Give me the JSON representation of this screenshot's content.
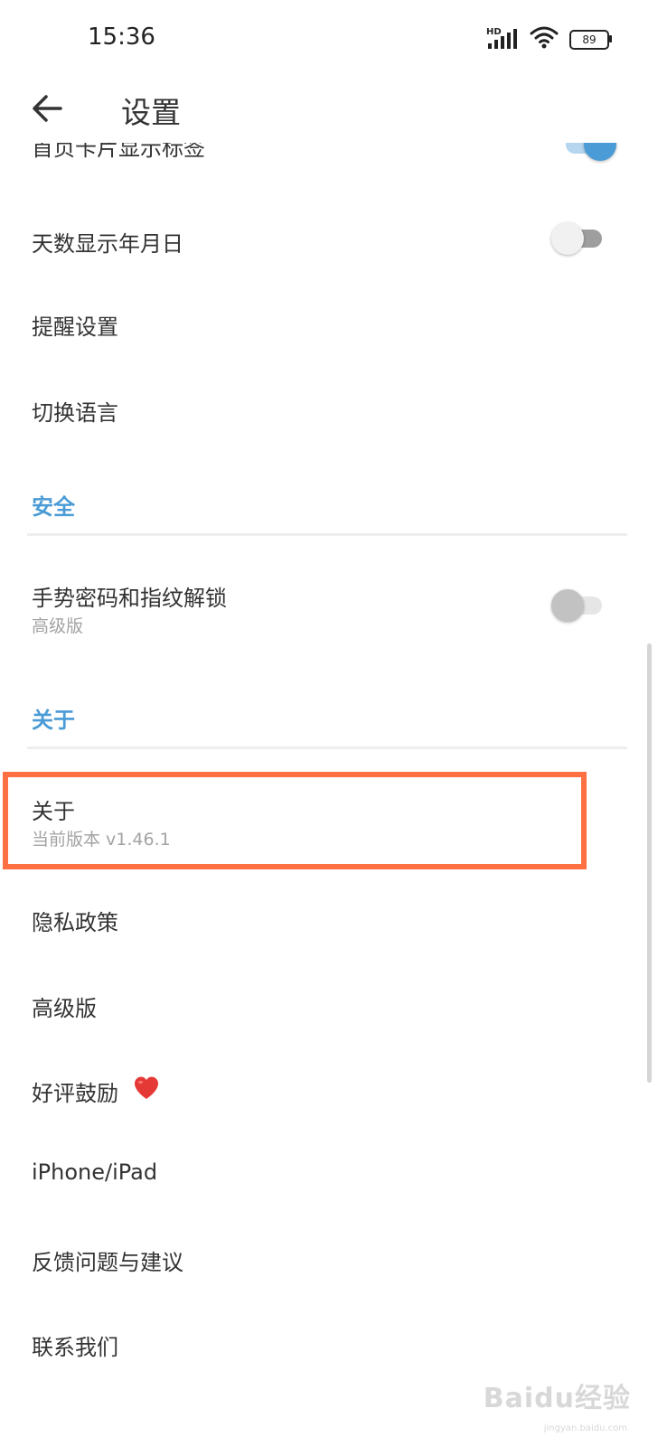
{
  "status_bar": {
    "time": "15:36",
    "network_label": "HD",
    "battery": "89"
  },
  "toolbar": {
    "title": "设置",
    "back_icon": "arrow-left-icon"
  },
  "settings": {
    "partial_item": {
      "label": "首页卡片显示标签",
      "toggle": "on"
    },
    "items_general": [
      {
        "label": "天数显示年月日",
        "toggle": "off"
      },
      {
        "label": "提醒设置"
      },
      {
        "label": "切换语言"
      }
    ],
    "section_security": {
      "title": "安全",
      "items": [
        {
          "label": "手势密码和指纹解锁",
          "sublabel": "高级版",
          "toggle": "off"
        }
      ]
    },
    "section_about": {
      "title": "关于",
      "items": [
        {
          "label": "关于",
          "sublabel": "当前版本 v1.46.1",
          "highlighted": true
        },
        {
          "label": "隐私政策"
        },
        {
          "label": "高级版"
        },
        {
          "label": "好评鼓励",
          "icon": "heart-icon"
        },
        {
          "label": "iPhone/iPad"
        },
        {
          "label": "反馈问题与建议"
        },
        {
          "label": "联系我们"
        }
      ]
    }
  },
  "colors": {
    "accent": "#4a9bd6",
    "highlight": "#ff7043",
    "heart": "#e53935"
  },
  "watermark": {
    "brand": "Baidu经验",
    "url": "jingyan.baidu.com"
  }
}
